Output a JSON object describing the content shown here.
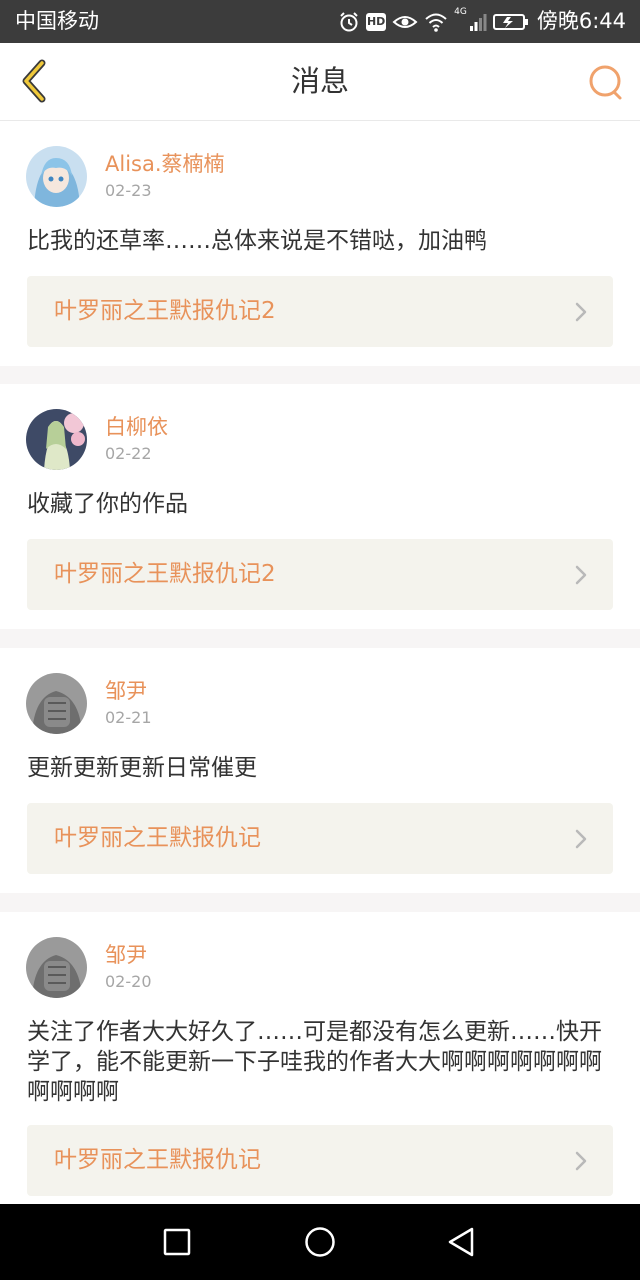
{
  "status_bar": {
    "carrier": "中国移动",
    "network": "4G",
    "time": "傍晚6:44",
    "hd_label": "HD"
  },
  "header": {
    "title": "消息",
    "back_icon": "chevron-left-icon",
    "search_icon": "search-icon"
  },
  "accent_color": "#e8925a",
  "messages": [
    {
      "username": "Alisa.蔡楠楠",
      "date": "02-23",
      "text": "比我的还草率……总体来说是不错哒，加油鸭",
      "work_title": "叶罗丽之王默报仇记2"
    },
    {
      "username": "白柳依",
      "date": "02-22",
      "text": "收藏了你的作品",
      "work_title": "叶罗丽之王默报仇记2"
    },
    {
      "username": "邹尹",
      "date": "02-21",
      "text": "更新更新更新日常催更",
      "work_title": "叶罗丽之王默报仇记"
    },
    {
      "username": "邹尹",
      "date": "02-20",
      "text": "关注了作者大大好久了……可是都没有怎么更新……快开学了，能不能更新一下子哇我的作者大大啊啊啊啊啊啊啊啊啊啊啊",
      "work_title": "叶罗丽之王默报仇记"
    }
  ],
  "nav_bar": {
    "recents_icon": "square-icon",
    "home_icon": "circle-icon",
    "back_icon": "triangle-back-icon"
  }
}
